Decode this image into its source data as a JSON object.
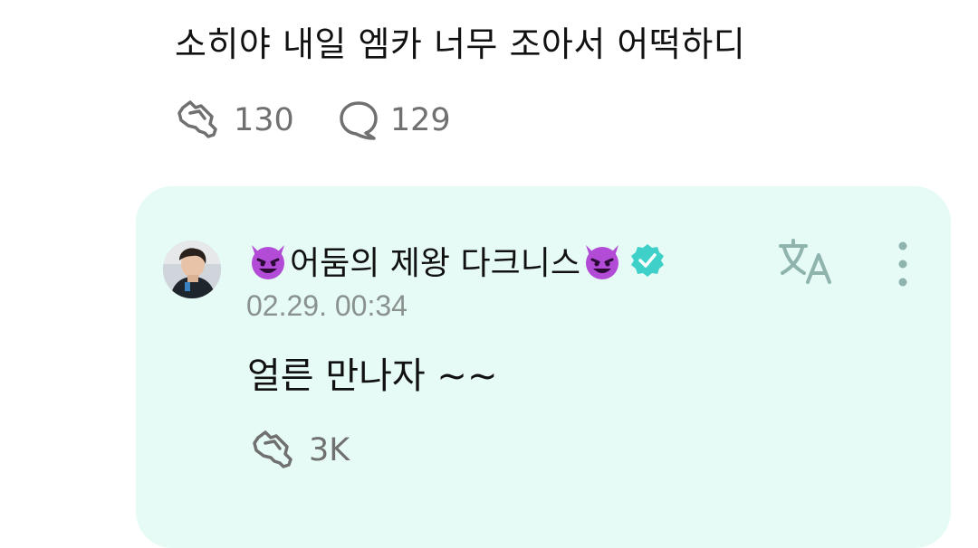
{
  "post": {
    "text": "소히야 내일 엠카 너무 조아서 어떡하디",
    "like_count": "130",
    "comment_count": "129",
    "like_icon": "heart-handshake-icon",
    "comment_icon": "speech-bubble-icon"
  },
  "reply": {
    "author_name": "어둠의 제왕 다크니스",
    "author_emoji": "smiling-face-with-horns",
    "verified": true,
    "timestamp": "02.29. 00:34",
    "text": "얼른 만나자 ~~",
    "like_count": "3K",
    "icons": [
      "translate-icon",
      "more-vertical-icon"
    ]
  },
  "colors": {
    "card_bg": "#e6fbf5",
    "icon_gray": "#707070",
    "teal_icon": "#8fb3ad",
    "verified": "#3fd1c9",
    "devil": "#b24cd6",
    "timestamp": "#8a9290"
  }
}
